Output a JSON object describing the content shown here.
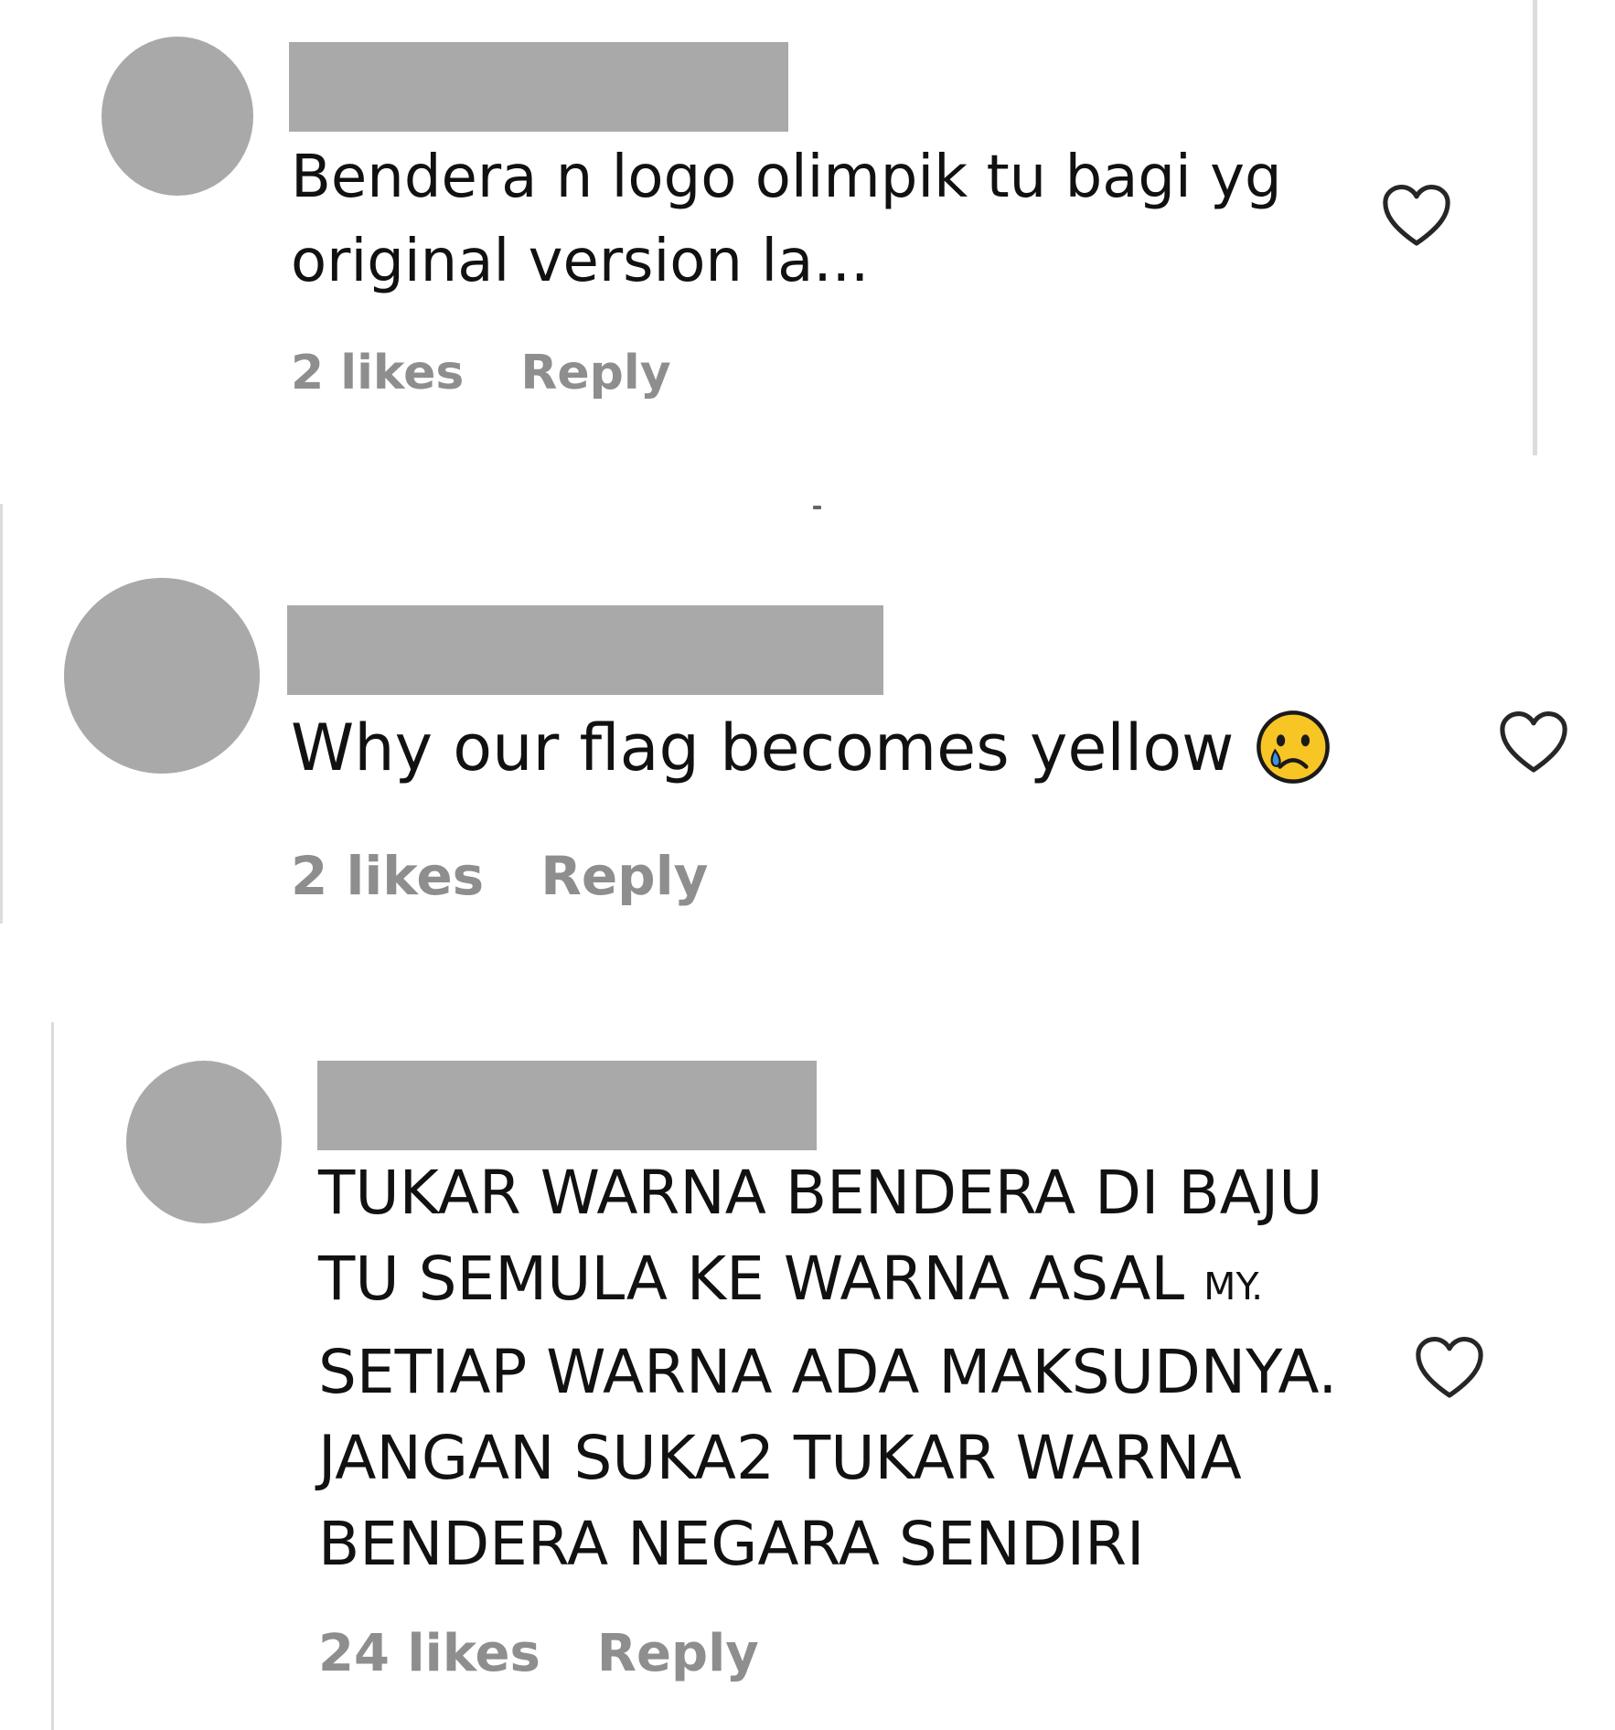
{
  "colors": {
    "text": "#111111",
    "meta": "#8e8e8e",
    "placeholder": "#a9a9a9",
    "divider": "#dcdcdc",
    "emoji_face": "#f7c524",
    "emoji_tear": "#3d8fe0"
  },
  "comments": [
    {
      "lines": [
        "Bendera n logo olimpik tu bagi yg",
        "original version la..."
      ],
      "likes": "2 likes",
      "reply": "Reply",
      "icon": "heart-outline-icon"
    },
    {
      "lines": [
        "Why our flag becomes yellow"
      ],
      "emoji": "crying-face-emoji",
      "likes": "2 likes",
      "reply": "Reply",
      "icon": "heart-outline-icon"
    },
    {
      "lines": [
        "TUKAR WARNA BENDERA DI BAJU",
        "TU SEMULA KE WARNA ASAL ",
        "SETIAP WARNA ADA MAKSUDNYA.",
        "JANGAN SUKA2 TUKAR WARNA",
        "BENDERA NEGARA SENDIRI"
      ],
      "line2_suffix": "MY.",
      "likes": "24 likes",
      "reply": "Reply",
      "icon": "heart-outline-icon"
    }
  ]
}
